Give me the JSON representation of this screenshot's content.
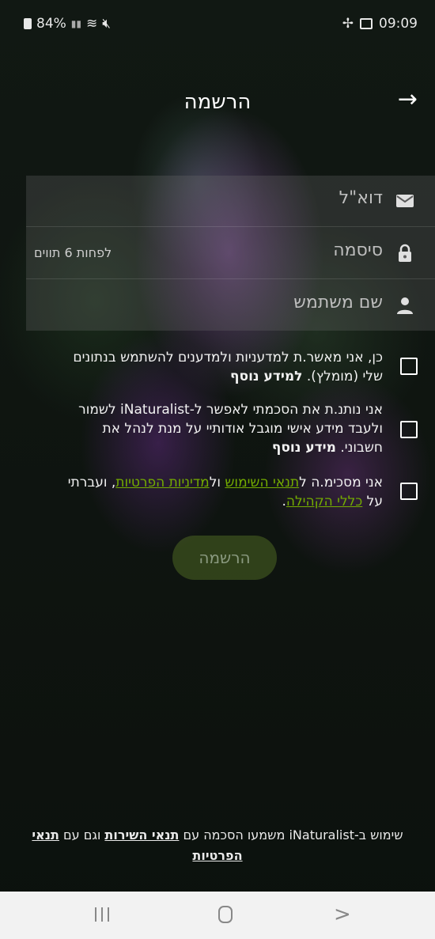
{
  "status_bar": {
    "battery": "84%",
    "time": "09:09"
  },
  "header": {
    "title": "הרשמה",
    "back_arrow": "→"
  },
  "form": {
    "email_label": "דוא\"ל",
    "password_label": "סיסמה",
    "password_hint": "לפחות 6 תווים",
    "username_label": "שם משתמש",
    "icons": [
      "email-icon",
      "lock-icon",
      "person-icon"
    ]
  },
  "consents": [
    {
      "text_line1": "כן, אני מאשר.ת למדעניות ולמדענים להשתמש בנתונים",
      "text_line2": "שלי (מומלץ). ",
      "more": "למידע נוסף"
    },
    {
      "text_line1": "אני נותנ.ת את הסכמתי לאפשר ל-iNaturalist לשמור",
      "text_line2": "ולעבד מידע אישי מוגבל אודותיי על מנת לנהל את",
      "text_line3": "חשבוני. ",
      "more": "מידע נוסף"
    },
    {
      "prefix": "אני מסכימ.ה ל",
      "terms_link": "תנאי השימוש",
      "mid": " ול",
      "privacy_link": "מדיניות הפרטיות",
      "mid2": ", ועברתי",
      "line2_prefix": "על ",
      "community_link": "כללי הקהילה",
      "suffix": "."
    }
  ],
  "submit_label": "הרשמה",
  "footer": {
    "prefix": "שימוש ב-iNaturalist משמעו הסכמה עם ",
    "terms": "תנאי השירות",
    "mid": " וגם עם ",
    "privacy_part1": "תנאי",
    "privacy_part2": "הפרטיות"
  },
  "colors": {
    "accent": "#74ac00",
    "navbar": "#f2f2f2"
  }
}
